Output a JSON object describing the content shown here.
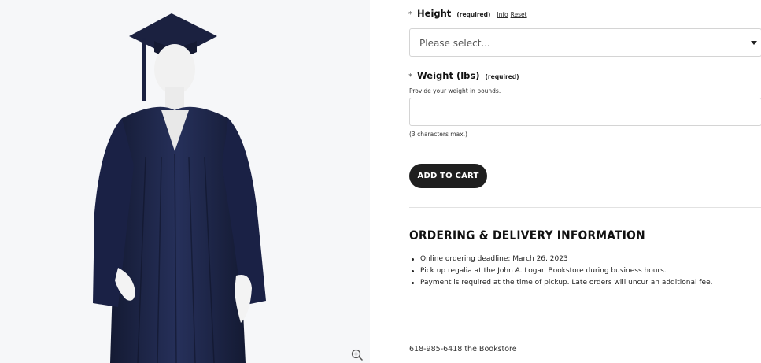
{
  "image": {
    "alt": "",
    "gown_color": "#1c2340",
    "zoom_icon": "zoom-in-icon"
  },
  "height_field": {
    "star": "*",
    "label": "Height",
    "required_note": "(required)",
    "info_link": "Info",
    "reset_link": "Reset",
    "select_value": "Please select...",
    "caret_icon": "chevron-down-icon"
  },
  "weight_field": {
    "star": "*",
    "label": "Weight (lbs)",
    "required_note": "(required)",
    "help": "Provide your weight in pounds.",
    "value": "",
    "max_note": "(3 characters max.)"
  },
  "cart": {
    "button_label": "ADD TO CART",
    "button_color": "#1f1f1f"
  },
  "ordering": {
    "title": "ORDERING & DELIVERY INFORMATION",
    "items": [
      "Online ordering deadline: March 26, 2023",
      "Pick up regalia at the John A. Logan Bookstore during business hours.",
      "Payment is required at the time of pickup. Late orders will uncur an additional fee."
    ]
  },
  "contact": {
    "phone_line": "618-985-6418 the Bookstore"
  }
}
